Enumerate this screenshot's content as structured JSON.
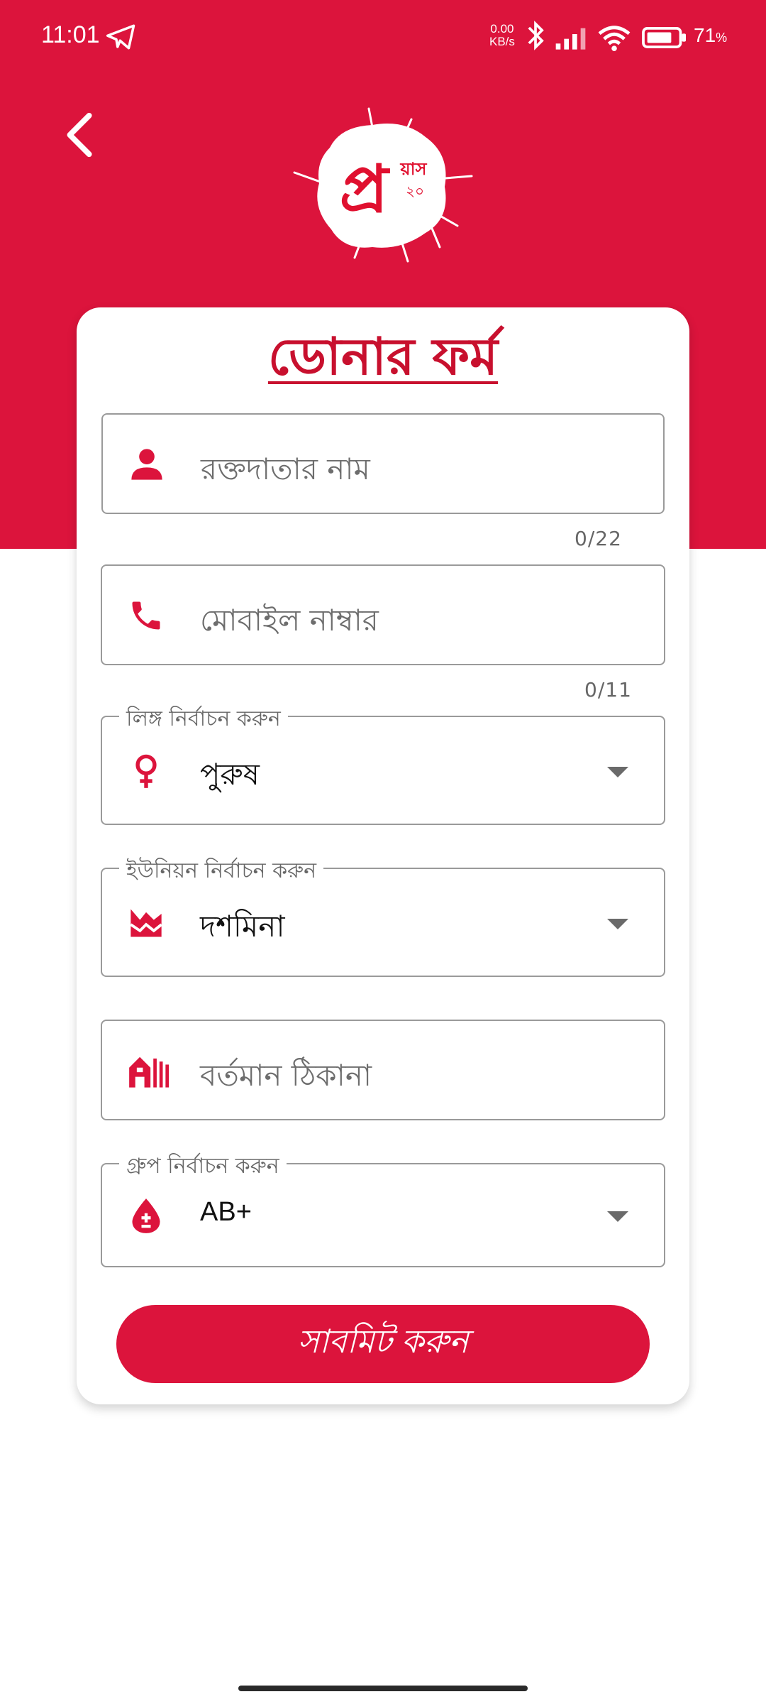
{
  "status_bar": {
    "time": "11:01",
    "net_speed_value": "0.00",
    "net_speed_unit": "KB/s",
    "battery_percent": "71",
    "battery_unit": "%"
  },
  "colors": {
    "primary": "#dc143c",
    "title": "#c8102e"
  },
  "header": {
    "back_icon": "chevron-left-icon",
    "logo_text_main": "প্র",
    "logo_text_side": "য়াস",
    "logo_text_num": "২০"
  },
  "form": {
    "title": "ডোনার ফর্ম",
    "name_field": {
      "placeholder": "রক্তদাতার নাম",
      "counter": "0/22",
      "icon": "person-icon"
    },
    "mobile_field": {
      "placeholder": "মোবাইল নাম্বার",
      "counter": "0/11",
      "icon": "phone-icon"
    },
    "gender_field": {
      "label": "লিঙ্গ নির্বাচন করুন",
      "value": "পুরুষ",
      "icon": "female-icon"
    },
    "union_field": {
      "label": "ইউনিয়ন নির্বাচন করুন",
      "value": "দশমিনা",
      "icon": "terrain-icon"
    },
    "address_field": {
      "placeholder": "বর্তমান ঠিকানা",
      "icon": "house-icon"
    },
    "group_field": {
      "label": "গ্রুপ নির্বাচন করুন",
      "value": "AB+",
      "icon": "blood-drop-icon"
    },
    "submit_label": "সাবমিট করুন"
  }
}
